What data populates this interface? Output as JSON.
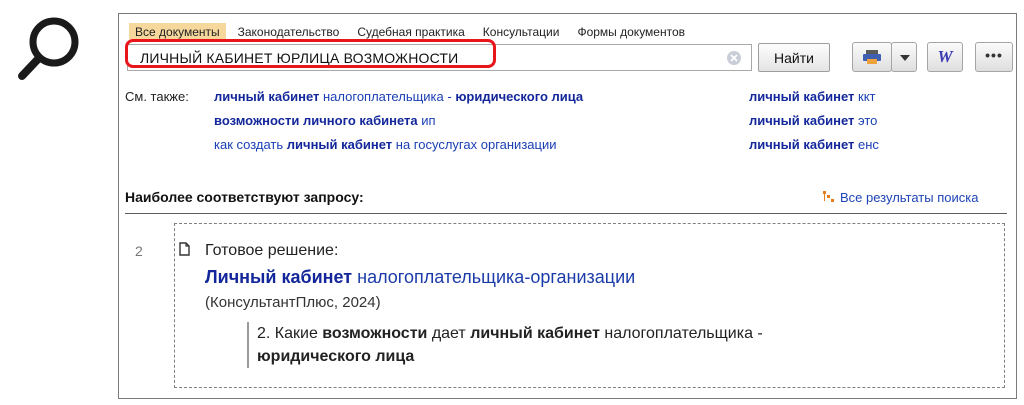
{
  "search_icon": "magnifier-icon",
  "tabs": [
    {
      "label": "Все документы",
      "active": true
    },
    {
      "label": "Законодательство",
      "active": false
    },
    {
      "label": "Судебная практика",
      "active": false
    },
    {
      "label": "Консультации",
      "active": false
    },
    {
      "label": "Формы документов",
      "active": false
    }
  ],
  "search": {
    "value": "ЛИЧНЫЙ КАБИНЕТ ЮРЛИЦА ВОЗМОЖНОСТИ",
    "find_label": "Найти"
  },
  "toolbar": {
    "print_icon": "printer-icon",
    "word_label": "W",
    "more_label": "•••"
  },
  "see_also": {
    "label": "См. также:",
    "links": [
      {
        "parts": [
          {
            "t": "личный кабинет",
            "b": true
          },
          {
            "t": " налогоплательщика - ",
            "b": false
          },
          {
            "t": "юридического лица",
            "b": true
          }
        ]
      },
      {
        "parts": [
          {
            "t": "возможности личного кабинета",
            "b": true
          },
          {
            "t": " ип",
            "b": false
          }
        ]
      },
      {
        "parts": [
          {
            "t": "как создать ",
            "b": false
          },
          {
            "t": "личный кабинет",
            "b": true
          },
          {
            "t": " на госуслугах организации",
            "b": false
          }
        ]
      },
      {
        "parts": [
          {
            "t": "личный кабинет",
            "b": true
          },
          {
            "t": " ккт",
            "b": false
          }
        ]
      },
      {
        "parts": [
          {
            "t": "личный кабинет",
            "b": true
          },
          {
            "t": " это",
            "b": false
          }
        ]
      },
      {
        "parts": [
          {
            "t": "личный кабинет",
            "b": true
          },
          {
            "t": " енс",
            "b": false
          }
        ]
      }
    ]
  },
  "best_match": {
    "title": "Наиболее соответствуют запросу:",
    "all_results_label": "Все результаты поиска"
  },
  "result": {
    "number": "2",
    "type": "Готовое решение:",
    "title_bold": "Личный кабинет",
    "title_rest": " налогоплательщика-организации",
    "source": "(КонсультантПлюс, 2024)",
    "snippet": [
      {
        "t": "2. Какие ",
        "b": false
      },
      {
        "t": "возможности",
        "b": true
      },
      {
        "t": " дает ",
        "b": false
      },
      {
        "t": "личный кабинет",
        "b": true
      },
      {
        "t": " налогоплательщика - ",
        "b": false
      },
      {
        "t": "юридического лица",
        "b": true
      }
    ]
  }
}
